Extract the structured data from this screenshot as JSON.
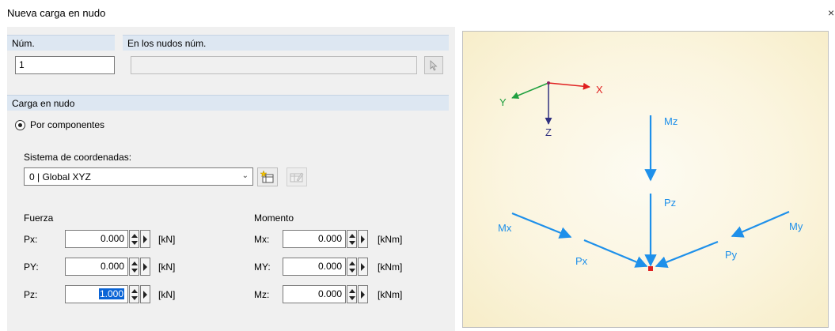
{
  "window": {
    "title": "Nueva carga en nudo",
    "close": "×"
  },
  "header": {
    "num_label": "Núm.",
    "num_value": "1",
    "nodes_label": "En los nudos núm.",
    "nodes_value": ""
  },
  "load": {
    "group_label": "Carga en nudo",
    "mode_label": "Por componentes",
    "coord_label": "Sistema de coordenadas:",
    "coord_value": "0 | Global XYZ"
  },
  "force": {
    "title": "Fuerza",
    "rows": [
      {
        "label": "Px:",
        "value": "0.000",
        "unit": "[kN]"
      },
      {
        "label": "PY:",
        "value": "0.000",
        "unit": "[kN]"
      },
      {
        "label": "Pz:",
        "value": "1.000",
        "unit": "[kN]"
      }
    ]
  },
  "moment": {
    "title": "Momento",
    "rows": [
      {
        "label": "Mx:",
        "value": "0.000",
        "unit": "[kNm]"
      },
      {
        "label": "MY:",
        "value": "0.000",
        "unit": "[kNm]"
      },
      {
        "label": "Mz:",
        "value": "0.000",
        "unit": "[kNm]"
      }
    ]
  },
  "diagram": {
    "axis_x": "X",
    "axis_y": "Y",
    "axis_z": "Z",
    "mz": "Mz",
    "pz": "Pz",
    "mx": "Mx",
    "px": "Px",
    "py": "Py",
    "my": "My",
    "colors": {
      "arrow": "#1e90ea",
      "x_axis": "#e02020",
      "y_axis": "#20a040",
      "z_axis": "#303080",
      "node": "#e02020"
    }
  }
}
